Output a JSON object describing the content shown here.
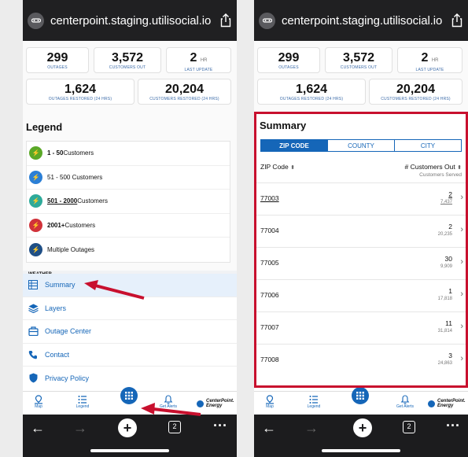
{
  "browser": {
    "url": "centerpoint.staging.utilisocial.io"
  },
  "stats": {
    "outages": {
      "value": "299",
      "label": "OUTAGES"
    },
    "customers_out": {
      "value": "3,572",
      "label": "CUSTOMERS OUT"
    },
    "last_update": {
      "value": "2",
      "unit": "HR",
      "label": "LAST UPDATE"
    },
    "restored_24": {
      "value": "1,624",
      "label": "OUTAGES RESTORED (24 HRS)"
    },
    "customers_restored_24": {
      "value": "20,204",
      "label": "CUSTOMERS RESTORED (24 HRS)"
    }
  },
  "legend": {
    "title": "Legend",
    "items": [
      {
        "label_bold": "1 - 50",
        "label": " Customers",
        "color": "#5aa827"
      },
      {
        "label_bold": "",
        "label": "51 - 500 Customers",
        "color": "#2b7fd6"
      },
      {
        "label_bold": "501 - 2000",
        "label": " Customers",
        "color": "#2eaa9a"
      },
      {
        "label_bold": "2001+",
        "label": " Customers",
        "color": "#d1323a"
      },
      {
        "label_bold": "",
        "label": "Multiple Outages",
        "color": "#1f4f86"
      }
    ]
  },
  "weather_label": "WEATHER",
  "menu": {
    "items": [
      {
        "label": "Summary",
        "icon": "table-icon"
      },
      {
        "label": "Layers",
        "icon": "layers-icon"
      },
      {
        "label": "Outage Center",
        "icon": "building-icon"
      },
      {
        "label": "Contact",
        "icon": "phone-icon"
      },
      {
        "label": "Privacy Policy",
        "icon": "shield-icon"
      }
    ]
  },
  "tabbar": {
    "map": "Map",
    "legend": "Legend",
    "alerts": "Get Alerts",
    "brand_line1": "CenterPoint.",
    "brand_line2": "Energy"
  },
  "summary": {
    "title": "Summary",
    "tabs": [
      "ZIP CODE",
      "COUNTY",
      "CITY"
    ],
    "col_zip": "ZIP Code",
    "col_out": "# Customers Out",
    "col_out_sub": "Customers Served",
    "rows": [
      {
        "zip": "77003",
        "out": "2",
        "served": "7,437"
      },
      {
        "zip": "77004",
        "out": "2",
        "served": "20,235"
      },
      {
        "zip": "77005",
        "out": "30",
        "served": "9,909"
      },
      {
        "zip": "77006",
        "out": "1",
        "served": "17,818"
      },
      {
        "zip": "77007",
        "out": "11",
        "served": "31,814"
      },
      {
        "zip": "77008",
        "out": "3",
        "served": "24,863"
      }
    ]
  },
  "safari": {
    "tabs_count": "2"
  },
  "colors": {
    "accent": "#1566b8",
    "highlight": "#c8102e"
  }
}
